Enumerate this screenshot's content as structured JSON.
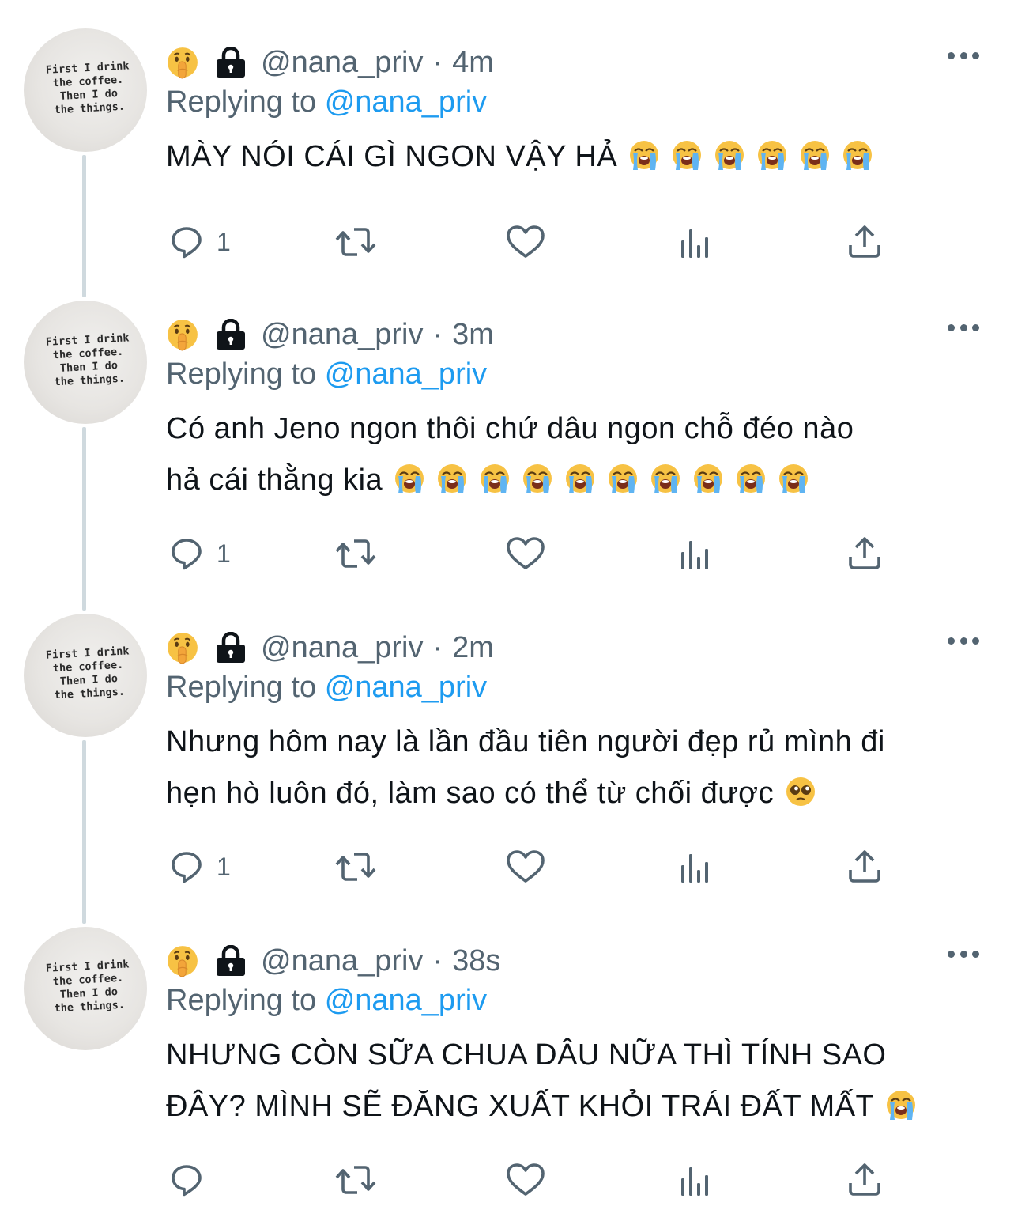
{
  "tweets": [
    {
      "handle": "@nana_priv",
      "time": "4m",
      "replying_label": "Replying to",
      "replying_to": "@nana_priv",
      "lines": [
        "MÀY NÓI CÁI GÌ NGON VẬY HẢ"
      ],
      "trailing_emoji": {
        "name": "loudly-crying-face",
        "count": 6
      },
      "reply_count": "1"
    },
    {
      "handle": "@nana_priv",
      "time": "3m",
      "replying_label": "Replying to",
      "replying_to": "@nana_priv",
      "lines": [
        "Có anh Jeno ngon thôi chứ dâu ngon chỗ đéo nào",
        "hả cái thằng kia"
      ],
      "trailing_emoji": {
        "name": "loudly-crying-face",
        "count": 10
      },
      "reply_count": "1"
    },
    {
      "handle": "@nana_priv",
      "time": "2m",
      "replying_label": "Replying to",
      "replying_to": "@nana_priv",
      "lines": [
        "Nhưng hôm nay là lần đầu tiên người đẹp rủ mình đi",
        "hẹn hò luôn đó, làm sao có thể từ chối được"
      ],
      "trailing_emoji": {
        "name": "pleading-face",
        "count": 1
      },
      "reply_count": "1"
    },
    {
      "handle": "@nana_priv",
      "time": "38s",
      "replying_label": "Replying to",
      "replying_to": "@nana_priv",
      "lines": [
        "NHƯNG CÒN SỮA CHUA DÂU NỮA THÌ TÍNH SAO",
        "ĐÂY? MÌNH SẼ ĐĂNG XUẤT KHỎI TRÁI ĐẤT MẤT"
      ],
      "trailing_emoji": {
        "name": "loudly-crying-face",
        "count": 1
      },
      "reply_count": ""
    }
  ],
  "avatar": {
    "lines": [
      "First I drink",
      "the coffee.",
      "Then I do",
      "the things."
    ]
  },
  "badges": {
    "emoji": "shushing-face",
    "lock": "lock-icon"
  },
  "icons": [
    "reply-icon",
    "retweet-icon",
    "like-icon",
    "analytics-icon",
    "share-icon",
    "more-icon"
  ],
  "colors": {
    "secondary": "#536471",
    "link": "#1d9bf0",
    "text": "#0f1419",
    "thread_line": "#cfd9de"
  }
}
